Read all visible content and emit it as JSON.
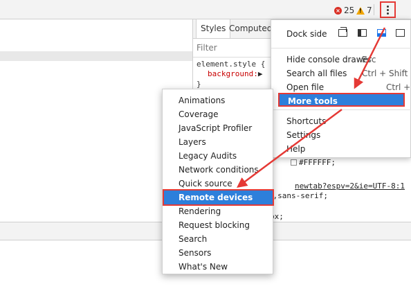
{
  "toolbar": {
    "error_count": "25",
    "warning_count": "7",
    "accent_error": "#d93025",
    "accent_warning": "#f2a600"
  },
  "styles_panel": {
    "tabs": [
      "Styles",
      "Computed"
    ],
    "filter_placeholder": "Filter",
    "code": {
      "rule_selector": "element.style {",
      "property": "background:",
      "close_brace": "}",
      "color_value": "#FFFFFF;",
      "link": "newtab?espv=2&ie=UTF-8:1",
      "font_value": "rial,sans-serif;",
      "px_value": "px;"
    }
  },
  "main_menu": {
    "dock_side_label": "Dock side",
    "items": [
      {
        "label": "Hide console drawer",
        "shortcut": "Esc"
      },
      {
        "label": "Search all files",
        "shortcut": "Ctrl + Shift + F"
      },
      {
        "label": "Open file",
        "shortcut": "Ctrl + P"
      },
      {
        "label": "More tools",
        "shortcut": ""
      },
      {
        "label": "Shortcuts",
        "shortcut": ""
      },
      {
        "label": "Settings",
        "shortcut": ""
      },
      {
        "label": "Help",
        "shortcut": ""
      }
    ],
    "highlight_color": "#2d7fdb",
    "annotation_color": "#e53935"
  },
  "more_tools_submenu": {
    "items": [
      "Animations",
      "Coverage",
      "JavaScript Profiler",
      "Layers",
      "Legacy Audits",
      "Network conditions",
      "Quick source",
      "Remote devices",
      "Rendering",
      "Request blocking",
      "Search",
      "Sensors",
      "What's New"
    ],
    "highlighted": "Remote devices"
  }
}
